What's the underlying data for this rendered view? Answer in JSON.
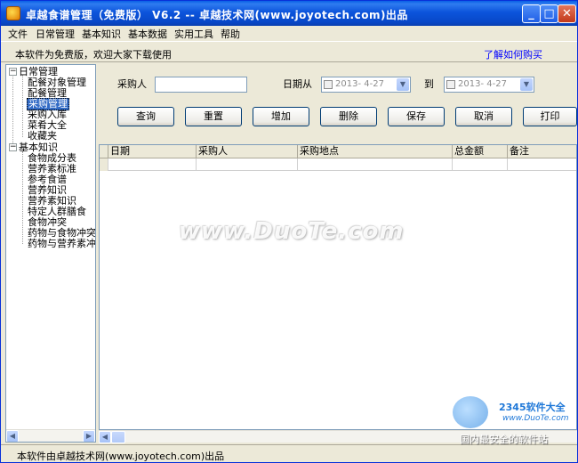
{
  "window": {
    "title": "卓越食谱管理（免费版） V6.2 -- 卓越技术网(www.joyotech.com)出品",
    "minimize_label": "_",
    "maximize_label": "□",
    "close_label": "✕"
  },
  "menu": [
    "文件",
    "日常管理",
    "基本知识",
    "基本数据",
    "实用工具",
    "帮助"
  ],
  "notice": {
    "text": "本软件为免费版，欢迎大家下载使用",
    "buy_link": "了解如何购买"
  },
  "tree": {
    "groups": [
      {
        "label": "日常管理",
        "items": [
          "配餐对象管理",
          "配餐管理",
          "采购管理",
          "采购入库",
          "菜肴大全",
          "收藏夹"
        ]
      },
      {
        "label": "基本知识",
        "items": [
          "食物成分表",
          "营养素标准",
          "参考食谱",
          "营养知识",
          "营养素知识",
          "特定人群膳食",
          "食物冲突",
          "药物与食物冲突",
          "药物与营养素冲突"
        ]
      }
    ],
    "selected": "采购管理",
    "expand_symbol": "−"
  },
  "filter": {
    "buyer_label": "采购人",
    "buyer_value": "",
    "date_from_label": "日期从",
    "date_from_value": "2013- 4-27",
    "date_to_label": "到",
    "date_to_value": "2013- 4-27"
  },
  "buttons": [
    "查询",
    "重置",
    "增加",
    "删除",
    "保存",
    "取消",
    "打印"
  ],
  "grid": {
    "columns": [
      "日期",
      "采购人",
      "采购地点",
      "总金额",
      "备注"
    ]
  },
  "status": {
    "text": "本软件由卓越技术网(www.joyotech.com)出品"
  },
  "watermarks": {
    "center": "www.DuoTe.com",
    "corner_brand": "2345软件大全",
    "corner_site": "www.DuoTe.com",
    "corner_slogan": "国内最安全的软件站"
  },
  "icons": {
    "scroll_left": "◀",
    "scroll_right": "▶",
    "dropdown": "▼"
  }
}
